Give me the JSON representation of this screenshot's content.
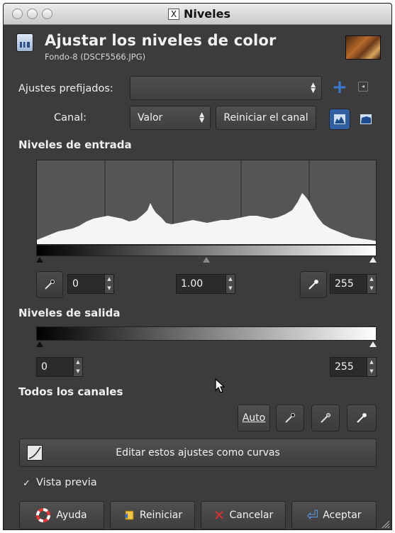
{
  "window": {
    "title": "Niveles"
  },
  "header": {
    "title": "Ajustar los niveles de color",
    "subtitle": "Fondo-8 (DSCF5566.JPG)"
  },
  "presets": {
    "label": "Ajustes prefijados:",
    "value": ""
  },
  "channel": {
    "label": "Canal:",
    "value": "Valor",
    "reset_label": "Reiniciar el canal"
  },
  "input_levels": {
    "heading": "Niveles de entrada",
    "black": "0",
    "gamma": "1.00",
    "white": "255"
  },
  "output_levels": {
    "heading": "Niveles de salida",
    "black": "0",
    "white": "255"
  },
  "all_channels": {
    "heading": "Todos los canales",
    "auto_label": "Auto"
  },
  "curves_button": {
    "label": "Editar estos ajustes como curvas"
  },
  "preview": {
    "label": "Vista previa",
    "checked": true,
    "check_glyph": "✓"
  },
  "footer": {
    "help": "Ayuda",
    "reset": "Reiniciar",
    "cancel": "Cancelar",
    "ok": "Aceptar"
  },
  "colors": {
    "panel": "#3c3c3c",
    "accent": "#3a7bd5",
    "cancel_red": "#d93030"
  }
}
